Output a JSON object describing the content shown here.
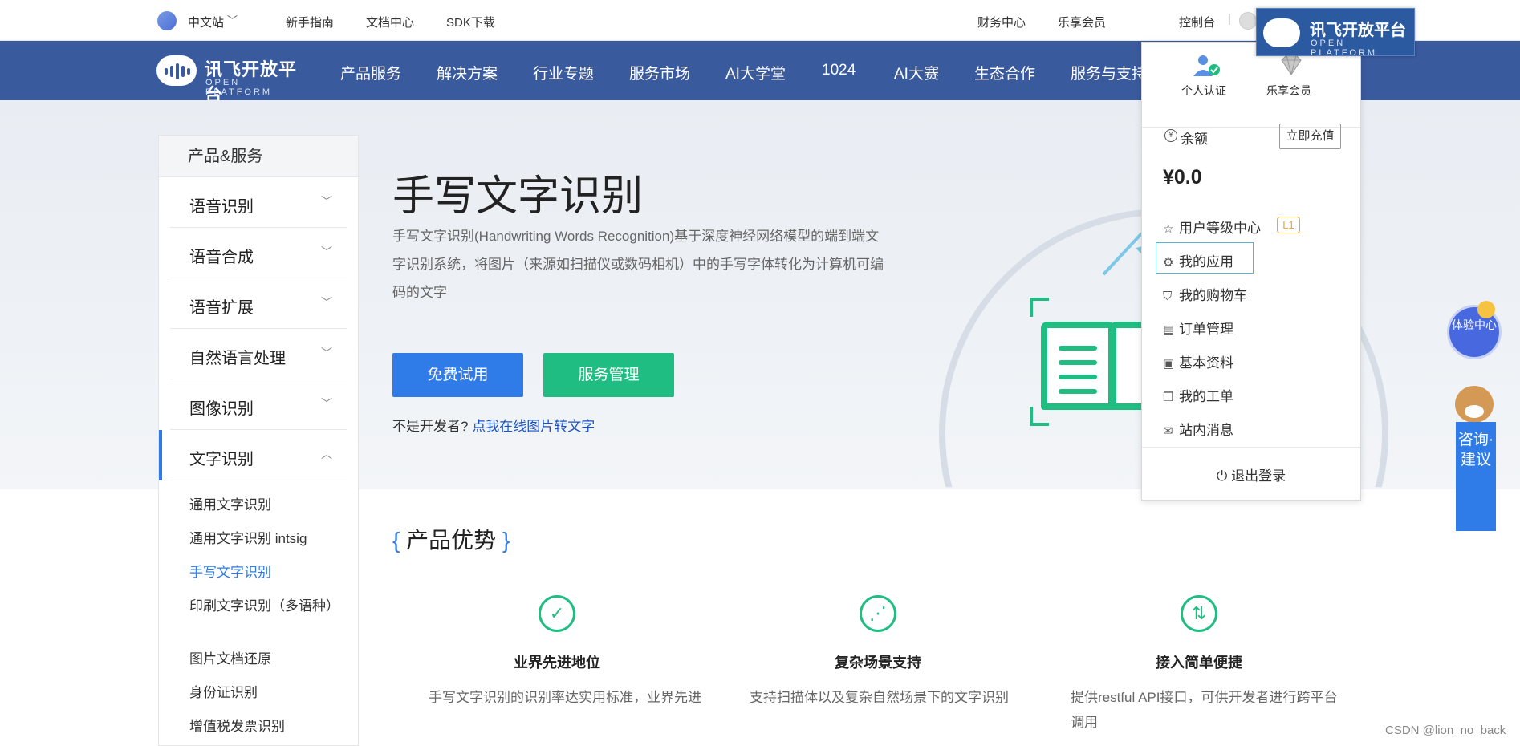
{
  "topbar": {
    "language": "中文站",
    "links": [
      "新手指南",
      "文档中心",
      "SDK下载"
    ],
    "finance": "财务中心",
    "member": "乐享会员",
    "console": "控制台",
    "separator": "|"
  },
  "brand": {
    "name": "讯飞开放平台",
    "sub": "OPEN PLATFORM"
  },
  "mainnav": {
    "items": [
      "产品服务",
      "解决方案",
      "行业专题",
      "服务市场",
      "AI大学堂",
      "1024",
      "AI大赛",
      "生态合作",
      "服务与支持"
    ]
  },
  "hero": {
    "title": "手写文字识别",
    "description": "手写文字识别(Handwriting Words Recognition)基于深度神经网络模型的端到端文字识别系统，将图片（来源如扫描仪或数码相机）中的手写字体转化为计算机可编码的文字",
    "try_button": "免费试用",
    "manage_button": "服务管理",
    "not_developer": "不是开发者?",
    "online_link": "点我在线图片转文字"
  },
  "sidebar": {
    "header": "产品&服务",
    "categories": [
      {
        "label": "语音识别",
        "chevron": "﹀"
      },
      {
        "label": "语音合成",
        "chevron": "﹀"
      },
      {
        "label": "语音扩展",
        "chevron": "﹀"
      },
      {
        "label": "自然语言处理",
        "chevron": "﹀"
      },
      {
        "label": "图像识别",
        "chevron": "﹀"
      },
      {
        "label": "文字识别",
        "chevron": "︿"
      }
    ],
    "subitems": [
      "通用文字识别",
      "通用文字识别 intsig",
      "手写文字识别",
      "印刷文字识别（多语种）",
      "图片文档还原",
      "身份证识别",
      "增值税发票识别"
    ],
    "current_subitem": "手写文字识别"
  },
  "advantages": {
    "bracket_open": "{",
    "title": "产品优势",
    "bracket_close": "}",
    "items": [
      {
        "icon": "check-circle-icon",
        "glyph": "✓",
        "heading": "业界先进地位",
        "text": "手写文字识别的识别率达实用标准，业界先进"
      },
      {
        "icon": "share-nodes-icon",
        "glyph": "⋰",
        "heading": "复杂场景支持",
        "text": "支持扫描体以及复杂自然场景下的文字识别"
      },
      {
        "icon": "transfer-arrows-icon",
        "glyph": "⇅",
        "heading": "接入简单便捷",
        "text": "提供restful API接口，可供开发者进行跨平台调用"
      }
    ]
  },
  "dropdown": {
    "personal_auth": "个人认证",
    "member": "乐享会员",
    "balance_label": "余额",
    "balance_icon": "¥",
    "recharge": "立即充值",
    "amount": "¥0.0",
    "level_center": "用户等级中心",
    "level_badge": "L1",
    "menu": [
      "我的应用",
      "我的购物车",
      "订单管理",
      "基本资料",
      "我的工单",
      "站内消息"
    ],
    "logout": "退出登录"
  },
  "widgets": {
    "experience": "体验中心",
    "consult": "咨询·建议"
  },
  "watermark": "CSDN @lion_no_back",
  "colors": {
    "nav_blue": "#3a5a9e",
    "primary_blue": "#2f7be8",
    "green": "#1fbd82",
    "level_orange": "#e7a832"
  }
}
